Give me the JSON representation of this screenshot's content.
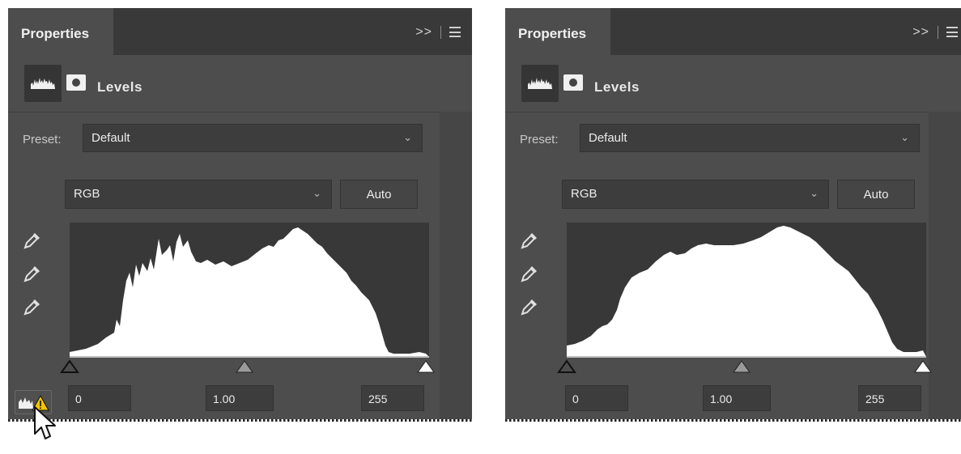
{
  "panels": [
    {
      "id": "left",
      "tab_label": "Properties",
      "menu_glyph": ">>",
      "title": "Levels",
      "preset_label": "Preset:",
      "preset_value": "Default",
      "channel_value": "RGB",
      "auto_label": "Auto",
      "inputs": {
        "black": "0",
        "gamma": "1.00",
        "white": "255"
      },
      "has_clip_warning_button": true,
      "histogram_shape": "jagged"
    },
    {
      "id": "right",
      "tab_label": "Properties",
      "menu_glyph": ">>",
      "title": "Levels",
      "preset_label": "Preset:",
      "preset_value": "Default",
      "channel_value": "RGB",
      "auto_label": "Auto",
      "inputs": {
        "black": "0",
        "gamma": "1.00",
        "white": "255"
      },
      "has_clip_warning_button": false,
      "histogram_shape": "smooth"
    }
  ],
  "icons": {
    "histogram": "histogram-icon",
    "mask": "mask-icon",
    "eyedroppers": [
      "black-point-eyedropper-icon",
      "gray-point-eyedropper-icon",
      "white-point-eyedropper-icon"
    ],
    "dropdown": "chevron-down-icon",
    "panel_menu": "panel-menu-icon",
    "clip_warning": "clipping-warning-icon",
    "cursor": "mouse-pointer-icon"
  },
  "colors": {
    "panel": "#4d4d4d",
    "tabbar": "#393939",
    "histogram_bg": "#383838",
    "histogram_fill": "#ffffff",
    "warning": "#f2c500"
  }
}
